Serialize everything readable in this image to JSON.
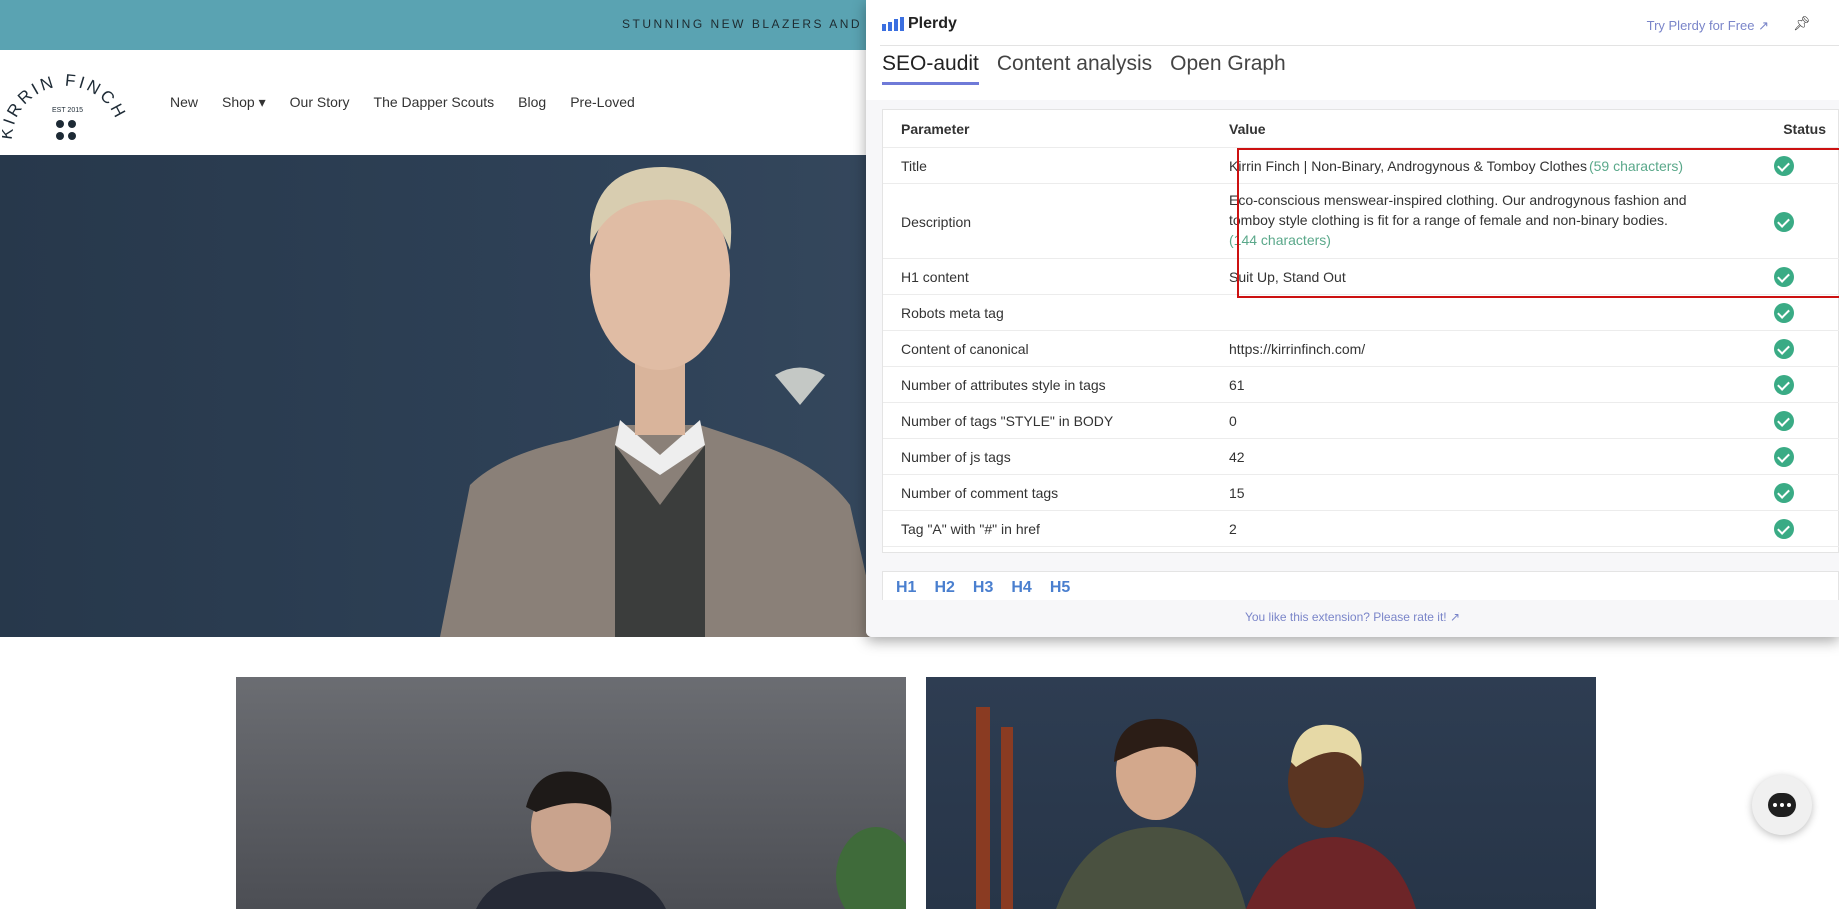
{
  "site": {
    "banner": "STUNNING NEW BLAZERS AND SUITS",
    "logo_text": "KIRRIN FINCH",
    "logo_est": "EST 2015",
    "nav": [
      "New",
      "Shop ▾",
      "Our Story",
      "The Dapper Scouts",
      "Blog",
      "Pre-Loved"
    ]
  },
  "panel": {
    "brand": "Plerdy",
    "try_link": "Try Plerdy for Free ↗",
    "tabs": [
      "SEO-audit",
      "Content analysis",
      "Open Graph"
    ],
    "active_tab": "SEO-audit",
    "columns": [
      "Parameter",
      "Value",
      "Status"
    ],
    "rows": [
      {
        "param": "Title",
        "value": "Kirrin Finch | Non-Binary, Androgynous & Tomboy Clothes",
        "count": "(59 characters)",
        "status": "ok"
      },
      {
        "param": "Description",
        "value": "Eco-conscious menswear-inspired clothing. Our androgynous fashion and tomboy style clothing is fit for a range of female and non-binary bodies.",
        "count": "(144 characters)",
        "status": "ok"
      },
      {
        "param": "H1 content",
        "value": "Suit Up, Stand Out",
        "count": "",
        "status": "ok"
      },
      {
        "param": "Robots meta tag",
        "value": "",
        "count": "",
        "status": "ok"
      },
      {
        "param": "Content of canonical",
        "value": "https://kirrinfinch.com/",
        "count": "",
        "status": "ok"
      },
      {
        "param": "Number of attributes style in tags",
        "value": "61",
        "count": "",
        "status": "ok"
      },
      {
        "param": "Number of tags \"STYLE\" in BODY",
        "value": "0",
        "count": "",
        "status": "ok"
      },
      {
        "param": "Number of js tags",
        "value": "42",
        "count": "",
        "status": "ok"
      },
      {
        "param": "Number of comment tags",
        "value": "15",
        "count": "",
        "status": "ok"
      },
      {
        "param": "Tag \"A\" with \"#\" in href",
        "value": "2",
        "count": "",
        "status": "ok"
      }
    ],
    "heading_tabs": [
      "H1",
      "H2",
      "H3",
      "H4",
      "H5"
    ],
    "footer": "You like this extension? Please rate it! ↗",
    "colors": {
      "accent": "#6f7ad8",
      "ok": "#3aab85",
      "highlight": "#cc1111"
    }
  }
}
